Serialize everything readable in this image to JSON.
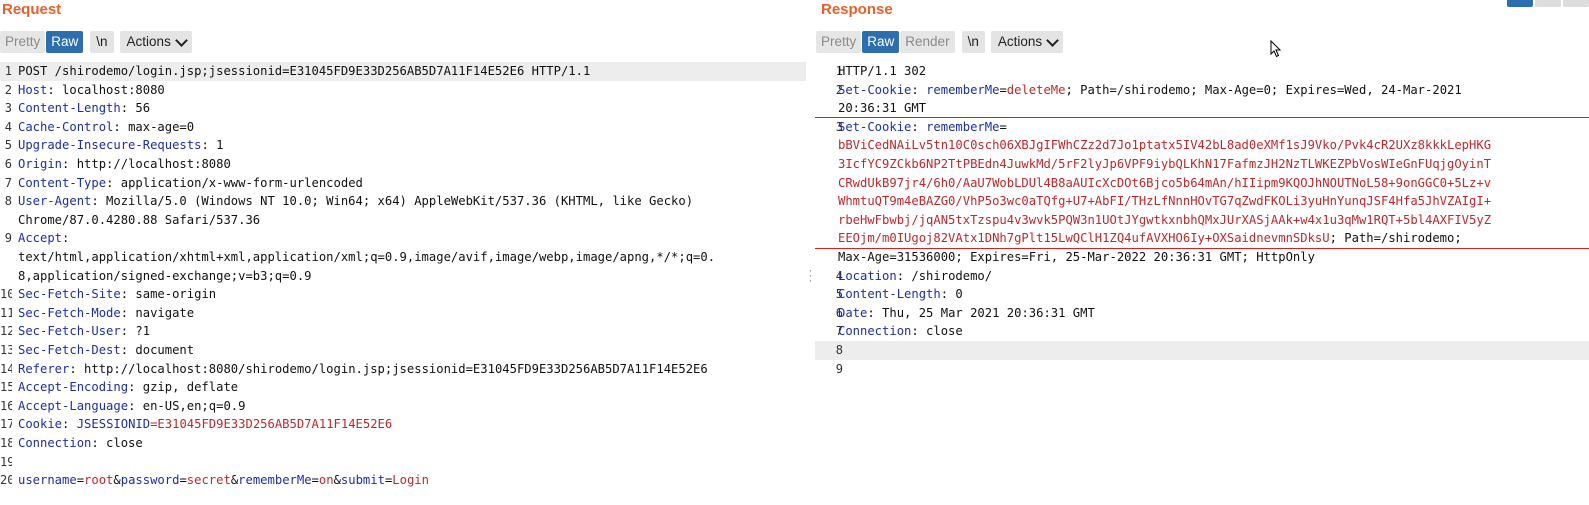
{
  "request": {
    "title": "Request",
    "toolbar": {
      "pretty": "Pretty",
      "raw": "Raw",
      "newline": "\\n",
      "actions": "Actions"
    },
    "lines": [
      {
        "n": "1",
        "segs": [
          {
            "t": "POST /shirodemo/login.jsp;jsessionid=E31045FD9E33D256AB5D7A11F14E52E6 HTTP/1.1",
            "c": "hv"
          }
        ]
      },
      {
        "n": "2",
        "segs": [
          {
            "t": "Host",
            "c": "hk"
          },
          {
            "t": ": localhost:8080",
            "c": "hv"
          }
        ]
      },
      {
        "n": "3",
        "segs": [
          {
            "t": "Content-Length",
            "c": "hk"
          },
          {
            "t": ": 56",
            "c": "hv"
          }
        ]
      },
      {
        "n": "4",
        "segs": [
          {
            "t": "Cache-Control",
            "c": "hk"
          },
          {
            "t": ": max-age=0",
            "c": "hv"
          }
        ]
      },
      {
        "n": "5",
        "segs": [
          {
            "t": "Upgrade-Insecure-Requests",
            "c": "hk"
          },
          {
            "t": ": 1",
            "c": "hv"
          }
        ]
      },
      {
        "n": "6",
        "segs": [
          {
            "t": "Origin",
            "c": "hk"
          },
          {
            "t": ": http://localhost:8080",
            "c": "hv"
          }
        ]
      },
      {
        "n": "7",
        "segs": [
          {
            "t": "Content-Type",
            "c": "hk"
          },
          {
            "t": ": application/x-www-form-urlencoded",
            "c": "hv"
          }
        ]
      },
      {
        "n": "8",
        "segs": [
          {
            "t": "User-Agent",
            "c": "hk"
          },
          {
            "t": ": Mozilla/5.0 (Windows NT 10.0; Win64; x64) AppleWebKit/537.36 (KHTML, like Gecko)",
            "c": "hv"
          }
        ]
      },
      {
        "n": "",
        "segs": [
          {
            "t": "Chrome/87.0.4280.88 Safari/537.36",
            "c": "hv"
          }
        ]
      },
      {
        "n": "9",
        "segs": [
          {
            "t": "Accept",
            "c": "hk"
          },
          {
            "t": ":",
            "c": "hv"
          }
        ]
      },
      {
        "n": "",
        "segs": [
          {
            "t": "text/html,application/xhtml+xml,application/xml;q=0.9,image/avif,image/webp,image/apng,*/*;q=0.",
            "c": "hv"
          }
        ]
      },
      {
        "n": "",
        "segs": [
          {
            "t": "8,application/signed-exchange;v=b3;q=0.9",
            "c": "hv"
          }
        ]
      },
      {
        "n": "10",
        "segs": [
          {
            "t": "Sec-Fetch-Site",
            "c": "hk"
          },
          {
            "t": ": same-origin",
            "c": "hv"
          }
        ]
      },
      {
        "n": "11",
        "segs": [
          {
            "t": "Sec-Fetch-Mode",
            "c": "hk"
          },
          {
            "t": ": navigate",
            "c": "hv"
          }
        ]
      },
      {
        "n": "12",
        "segs": [
          {
            "t": "Sec-Fetch-User",
            "c": "hk"
          },
          {
            "t": ": ?1",
            "c": "hv"
          }
        ]
      },
      {
        "n": "13",
        "segs": [
          {
            "t": "Sec-Fetch-Dest",
            "c": "hk"
          },
          {
            "t": ": document",
            "c": "hv"
          }
        ]
      },
      {
        "n": "14",
        "segs": [
          {
            "t": "Referer",
            "c": "hk"
          },
          {
            "t": ": http://localhost:8080/shirodemo/login.jsp;jsessionid=E31045FD9E33D256AB5D7A11F14E52E6",
            "c": "hv"
          }
        ]
      },
      {
        "n": "15",
        "segs": [
          {
            "t": "Accept-Encoding",
            "c": "hk"
          },
          {
            "t": ": gzip, deflate",
            "c": "hv"
          }
        ]
      },
      {
        "n": "16",
        "segs": [
          {
            "t": "Accept-Language",
            "c": "hk"
          },
          {
            "t": ": en-US,en;q=0.9",
            "c": "hv"
          }
        ]
      },
      {
        "n": "17",
        "segs": [
          {
            "t": "Cookie",
            "c": "hk"
          },
          {
            "t": ": ",
            "c": "hv"
          },
          {
            "t": "JSESSIONID",
            "c": "ck"
          },
          {
            "t": "=E31045FD9E33D256AB5D7A11F14E52E6",
            "c": "cv"
          }
        ]
      },
      {
        "n": "18",
        "segs": [
          {
            "t": "Connection",
            "c": "hk"
          },
          {
            "t": ": close",
            "c": "hv"
          }
        ]
      },
      {
        "n": "19",
        "segs": []
      },
      {
        "n": "20",
        "segs": [
          {
            "t": "username",
            "c": "pk"
          },
          {
            "t": "=",
            "c": "amp"
          },
          {
            "t": "root",
            "c": "pv"
          },
          {
            "t": "&",
            "c": "amp"
          },
          {
            "t": "password",
            "c": "pk"
          },
          {
            "t": "=",
            "c": "amp"
          },
          {
            "t": "secret",
            "c": "pv"
          },
          {
            "t": "&",
            "c": "amp"
          },
          {
            "t": "rememberMe",
            "c": "pk"
          },
          {
            "t": "=",
            "c": "amp"
          },
          {
            "t": "on",
            "c": "pv"
          },
          {
            "t": "&",
            "c": "amp"
          },
          {
            "t": "submit",
            "c": "pk"
          },
          {
            "t": "=",
            "c": "amp"
          },
          {
            "t": "Login",
            "c": "pv"
          }
        ]
      }
    ]
  },
  "response": {
    "title": "Response",
    "toolbar": {
      "pretty": "Pretty",
      "raw": "Raw",
      "render": "Render",
      "newline": "\\n",
      "actions": "Actions"
    },
    "lines": [
      {
        "n": "1",
        "segs": [
          {
            "t": "HTTP/1.1 302",
            "c": "hv"
          }
        ]
      },
      {
        "n": "2",
        "segs": [
          {
            "t": "Set-Cookie",
            "c": "hk"
          },
          {
            "t": ": ",
            "c": "hv"
          },
          {
            "t": "rememberMe",
            "c": "ck"
          },
          {
            "t": "=",
            "c": "hv"
          },
          {
            "t": "deleteMe",
            "c": "cv"
          },
          {
            "t": "; Path=/shirodemo; Max-Age=0; Expires=Wed, 24-Mar-2021",
            "c": "hv"
          }
        ]
      },
      {
        "n": "",
        "segs": [
          {
            "t": "20:36:31 GMT",
            "c": "hv"
          }
        ]
      },
      {
        "n": "3",
        "segs": [
          {
            "t": "Set-Cookie",
            "c": "hk"
          },
          {
            "t": ": ",
            "c": "hv"
          },
          {
            "t": "rememberMe",
            "c": "ck"
          },
          {
            "t": "=",
            "c": "hv"
          }
        ]
      },
      {
        "n": "",
        "segs": [
          {
            "t": "bBViCedNAiLv5tn10C0sch06XBJgIFWhCZz2d7Jo1ptatx5IV42bL8ad0eXMf1sJ9Vko/Pvk4cR2UXz8kkkLepHKG",
            "c": "cv"
          }
        ]
      },
      {
        "n": "",
        "segs": [
          {
            "t": "3IcfYC9ZCkb6NP2TtPBEdn4JuwkMd/5rF2lyJp6VPF9iybQLKhN17FafmzJH2NzTLWKEZPbVosWIeGnFUqjgOyinT",
            "c": "cv"
          }
        ]
      },
      {
        "n": "",
        "segs": [
          {
            "t": "CRwdUkB97jr4/6h0/AaU7WobLDUl4B8aAUIcXcDOt6Bjco5b64mAn/hIIipm9KQOJhNOUTNoL58+9onGGC0+5Lz+v",
            "c": "cv"
          }
        ]
      },
      {
        "n": "",
        "segs": [
          {
            "t": "WhmtuQT9m4eBAZG0/VhP5o3wc0aTQfg+U7+AbFI/THzLfNnnHOvTG7qZwdFKOLi3yuHnYunqJSF4Hfa5JhVZAIgI+",
            "c": "cv"
          }
        ]
      },
      {
        "n": "",
        "segs": [
          {
            "t": "rbeHwFbwbj/jqAN5txTzspu4v3wvk5PQW3n1UOtJYgwtkxnbhQMxJUrXASjAAk+w4x1u3qMw1RQT+5bl4AXFIV5yZ",
            "c": "cv"
          }
        ]
      },
      {
        "n": "",
        "segs": [
          {
            "t": "EEOjm/m0IUgoj82VAtx1DNh7gPlt15LwQClH1ZQ4ufAVXHO6Iy+OXSaidnevmnSDksU",
            "c": "cv"
          },
          {
            "t": "; Path=/shirodemo;",
            "c": "hv"
          }
        ]
      },
      {
        "n": "",
        "segs": [
          {
            "t": "Max-Age=31536000; Expires=Fri, 25-Mar-2022 20:36:31 GMT; HttpOnly",
            "c": "hv"
          }
        ]
      },
      {
        "n": "4",
        "segs": [
          {
            "t": "Location",
            "c": "hk"
          },
          {
            "t": ": /shirodemo/",
            "c": "hv"
          }
        ]
      },
      {
        "n": "5",
        "segs": [
          {
            "t": "Content-Length",
            "c": "hk"
          },
          {
            "t": ": 0",
            "c": "hv"
          }
        ]
      },
      {
        "n": "6",
        "segs": [
          {
            "t": "Date",
            "c": "hk"
          },
          {
            "t": ": Thu, 25 Mar 2021 20:36:31 GMT",
            "c": "hv"
          }
        ]
      },
      {
        "n": "7",
        "segs": [
          {
            "t": "Connection",
            "c": "hk"
          },
          {
            "t": ": close",
            "c": "hv"
          }
        ]
      },
      {
        "n": "8",
        "segs": []
      },
      {
        "n": "9",
        "segs": []
      }
    ]
  }
}
